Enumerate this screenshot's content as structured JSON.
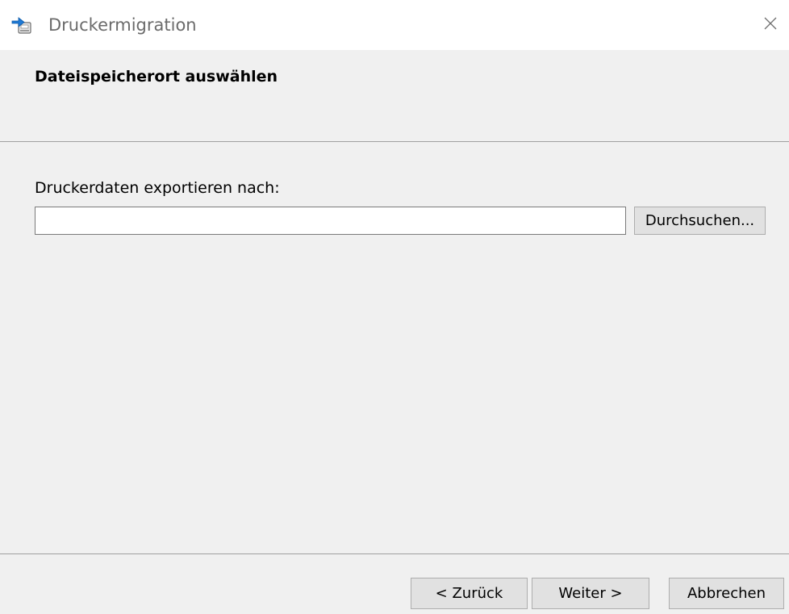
{
  "window": {
    "title": "Druckermigration",
    "icon": "printer-migration-icon",
    "close_icon": "close-icon"
  },
  "header": {
    "title": "Dateispeicherort auswählen"
  },
  "main": {
    "export_label": "Druckerdaten exportieren nach:",
    "path_value": "",
    "browse_label": "Durchsuchen..."
  },
  "footer": {
    "back_label": "< Zurück",
    "next_label": "Weiter >",
    "cancel_label": "Abbrechen"
  },
  "colors": {
    "window_bg": "#f0f0f0",
    "titlebar_bg": "#ffffff",
    "button_bg": "#e1e1e1",
    "button_border": "#adadad",
    "separator": "#a0a0a0",
    "icon_accent": "#1e7ad6"
  }
}
